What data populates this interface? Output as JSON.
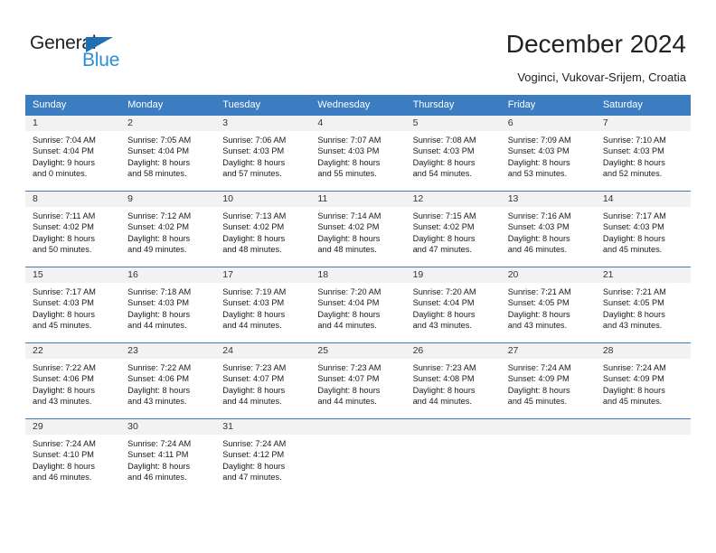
{
  "brand": {
    "name_top": "General",
    "name_bottom": "Blue",
    "accent_dark": "#231f20",
    "accent_blue": "#2b8fd8",
    "triangle_blue": "#1f6fb5"
  },
  "header": {
    "title": "December 2024",
    "subtitle": "Voginci, Vukovar-Srijem, Croatia"
  },
  "theme": {
    "header_bg": "#3b7dc0",
    "header_text": "#ffffff",
    "daynum_bg": "#f2f2f2",
    "cell_bg": "#ffffff",
    "text": "#1a1a1a"
  },
  "weekdays": [
    "Sunday",
    "Monday",
    "Tuesday",
    "Wednesday",
    "Thursday",
    "Friday",
    "Saturday"
  ],
  "weeks": [
    [
      {
        "day": "1",
        "sunrise": "Sunrise: 7:04 AM",
        "sunset": "Sunset: 4:04 PM",
        "daylight1": "Daylight: 9 hours",
        "daylight2": "and 0 minutes."
      },
      {
        "day": "2",
        "sunrise": "Sunrise: 7:05 AM",
        "sunset": "Sunset: 4:04 PM",
        "daylight1": "Daylight: 8 hours",
        "daylight2": "and 58 minutes."
      },
      {
        "day": "3",
        "sunrise": "Sunrise: 7:06 AM",
        "sunset": "Sunset: 4:03 PM",
        "daylight1": "Daylight: 8 hours",
        "daylight2": "and 57 minutes."
      },
      {
        "day": "4",
        "sunrise": "Sunrise: 7:07 AM",
        "sunset": "Sunset: 4:03 PM",
        "daylight1": "Daylight: 8 hours",
        "daylight2": "and 55 minutes."
      },
      {
        "day": "5",
        "sunrise": "Sunrise: 7:08 AM",
        "sunset": "Sunset: 4:03 PM",
        "daylight1": "Daylight: 8 hours",
        "daylight2": "and 54 minutes."
      },
      {
        "day": "6",
        "sunrise": "Sunrise: 7:09 AM",
        "sunset": "Sunset: 4:03 PM",
        "daylight1": "Daylight: 8 hours",
        "daylight2": "and 53 minutes."
      },
      {
        "day": "7",
        "sunrise": "Sunrise: 7:10 AM",
        "sunset": "Sunset: 4:03 PM",
        "daylight1": "Daylight: 8 hours",
        "daylight2": "and 52 minutes."
      }
    ],
    [
      {
        "day": "8",
        "sunrise": "Sunrise: 7:11 AM",
        "sunset": "Sunset: 4:02 PM",
        "daylight1": "Daylight: 8 hours",
        "daylight2": "and 50 minutes."
      },
      {
        "day": "9",
        "sunrise": "Sunrise: 7:12 AM",
        "sunset": "Sunset: 4:02 PM",
        "daylight1": "Daylight: 8 hours",
        "daylight2": "and 49 minutes."
      },
      {
        "day": "10",
        "sunrise": "Sunrise: 7:13 AM",
        "sunset": "Sunset: 4:02 PM",
        "daylight1": "Daylight: 8 hours",
        "daylight2": "and 48 minutes."
      },
      {
        "day": "11",
        "sunrise": "Sunrise: 7:14 AM",
        "sunset": "Sunset: 4:02 PM",
        "daylight1": "Daylight: 8 hours",
        "daylight2": "and 48 minutes."
      },
      {
        "day": "12",
        "sunrise": "Sunrise: 7:15 AM",
        "sunset": "Sunset: 4:02 PM",
        "daylight1": "Daylight: 8 hours",
        "daylight2": "and 47 minutes."
      },
      {
        "day": "13",
        "sunrise": "Sunrise: 7:16 AM",
        "sunset": "Sunset: 4:03 PM",
        "daylight1": "Daylight: 8 hours",
        "daylight2": "and 46 minutes."
      },
      {
        "day": "14",
        "sunrise": "Sunrise: 7:17 AM",
        "sunset": "Sunset: 4:03 PM",
        "daylight1": "Daylight: 8 hours",
        "daylight2": "and 45 minutes."
      }
    ],
    [
      {
        "day": "15",
        "sunrise": "Sunrise: 7:17 AM",
        "sunset": "Sunset: 4:03 PM",
        "daylight1": "Daylight: 8 hours",
        "daylight2": "and 45 minutes."
      },
      {
        "day": "16",
        "sunrise": "Sunrise: 7:18 AM",
        "sunset": "Sunset: 4:03 PM",
        "daylight1": "Daylight: 8 hours",
        "daylight2": "and 44 minutes."
      },
      {
        "day": "17",
        "sunrise": "Sunrise: 7:19 AM",
        "sunset": "Sunset: 4:03 PM",
        "daylight1": "Daylight: 8 hours",
        "daylight2": "and 44 minutes."
      },
      {
        "day": "18",
        "sunrise": "Sunrise: 7:20 AM",
        "sunset": "Sunset: 4:04 PM",
        "daylight1": "Daylight: 8 hours",
        "daylight2": "and 44 minutes."
      },
      {
        "day": "19",
        "sunrise": "Sunrise: 7:20 AM",
        "sunset": "Sunset: 4:04 PM",
        "daylight1": "Daylight: 8 hours",
        "daylight2": "and 43 minutes."
      },
      {
        "day": "20",
        "sunrise": "Sunrise: 7:21 AM",
        "sunset": "Sunset: 4:05 PM",
        "daylight1": "Daylight: 8 hours",
        "daylight2": "and 43 minutes."
      },
      {
        "day": "21",
        "sunrise": "Sunrise: 7:21 AM",
        "sunset": "Sunset: 4:05 PM",
        "daylight1": "Daylight: 8 hours",
        "daylight2": "and 43 minutes."
      }
    ],
    [
      {
        "day": "22",
        "sunrise": "Sunrise: 7:22 AM",
        "sunset": "Sunset: 4:06 PM",
        "daylight1": "Daylight: 8 hours",
        "daylight2": "and 43 minutes."
      },
      {
        "day": "23",
        "sunrise": "Sunrise: 7:22 AM",
        "sunset": "Sunset: 4:06 PM",
        "daylight1": "Daylight: 8 hours",
        "daylight2": "and 43 minutes."
      },
      {
        "day": "24",
        "sunrise": "Sunrise: 7:23 AM",
        "sunset": "Sunset: 4:07 PM",
        "daylight1": "Daylight: 8 hours",
        "daylight2": "and 44 minutes."
      },
      {
        "day": "25",
        "sunrise": "Sunrise: 7:23 AM",
        "sunset": "Sunset: 4:07 PM",
        "daylight1": "Daylight: 8 hours",
        "daylight2": "and 44 minutes."
      },
      {
        "day": "26",
        "sunrise": "Sunrise: 7:23 AM",
        "sunset": "Sunset: 4:08 PM",
        "daylight1": "Daylight: 8 hours",
        "daylight2": "and 44 minutes."
      },
      {
        "day": "27",
        "sunrise": "Sunrise: 7:24 AM",
        "sunset": "Sunset: 4:09 PM",
        "daylight1": "Daylight: 8 hours",
        "daylight2": "and 45 minutes."
      },
      {
        "day": "28",
        "sunrise": "Sunrise: 7:24 AM",
        "sunset": "Sunset: 4:09 PM",
        "daylight1": "Daylight: 8 hours",
        "daylight2": "and 45 minutes."
      }
    ],
    [
      {
        "day": "29",
        "sunrise": "Sunrise: 7:24 AM",
        "sunset": "Sunset: 4:10 PM",
        "daylight1": "Daylight: 8 hours",
        "daylight2": "and 46 minutes."
      },
      {
        "day": "30",
        "sunrise": "Sunrise: 7:24 AM",
        "sunset": "Sunset: 4:11 PM",
        "daylight1": "Daylight: 8 hours",
        "daylight2": "and 46 minutes."
      },
      {
        "day": "31",
        "sunrise": "Sunrise: 7:24 AM",
        "sunset": "Sunset: 4:12 PM",
        "daylight1": "Daylight: 8 hours",
        "daylight2": "and 47 minutes."
      },
      null,
      null,
      null,
      null
    ]
  ]
}
